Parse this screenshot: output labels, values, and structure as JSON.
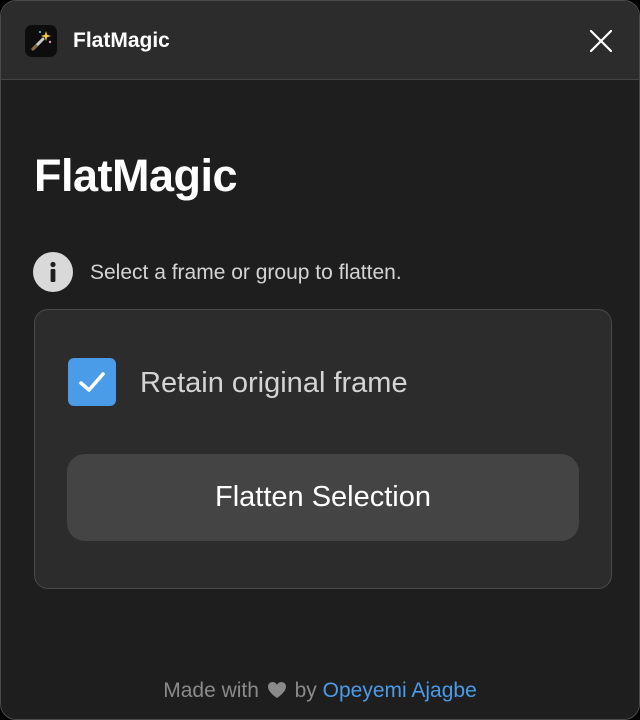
{
  "window": {
    "title": "FlatMagic",
    "app_icon": "magic-wand-icon",
    "close_icon": "close-icon"
  },
  "main": {
    "heading": "FlatMagic",
    "info_icon": "info-icon",
    "info_text": "Select a frame or group to flatten."
  },
  "panel": {
    "retain_checked": true,
    "retain_label": "Retain original frame",
    "flatten_button": "Flatten Selection"
  },
  "footer": {
    "made_with": "Made with",
    "heart_icon": "heart-icon",
    "by": "by",
    "author": "Opeyemi Ajagbe"
  },
  "colors": {
    "accent": "#4a9be8",
    "background": "#1e1e1e",
    "titlebar": "#2c2c2c",
    "button": "#444444"
  }
}
